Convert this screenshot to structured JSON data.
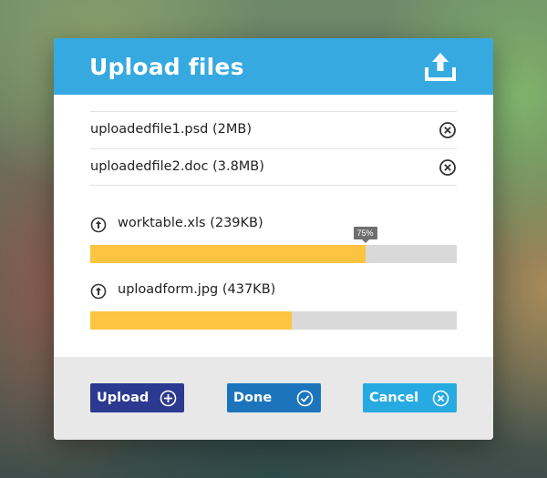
{
  "dialog": {
    "title": "Upload files",
    "header_icon": "upload-tray-icon"
  },
  "files": [
    {
      "label": "uploadedfile1.psd (2MB)",
      "remove_icon": "remove-circle-x-icon"
    },
    {
      "label": "uploadedfile2.doc (3.8MB)",
      "remove_icon": "remove-circle-x-icon"
    }
  ],
  "uploads": [
    {
      "label": "worktable.xls (239KB)",
      "progress": 0.75,
      "progress_label": "75%",
      "icon": "up-arrow-circle-icon"
    },
    {
      "label": "uploadform.jpg (437KB)",
      "progress": 0.55,
      "icon": "up-arrow-circle-icon"
    }
  ],
  "buttons": {
    "upload_label": "Upload",
    "done_label": "Done",
    "cancel_label": "Cancel"
  },
  "colors": {
    "header": "#36a9e1",
    "progress_fill": "#fcc440",
    "progress_track": "#d9d9d9",
    "upload_button": "#2b3990",
    "done_button": "#1c75bc",
    "cancel_button": "#27aae1"
  }
}
